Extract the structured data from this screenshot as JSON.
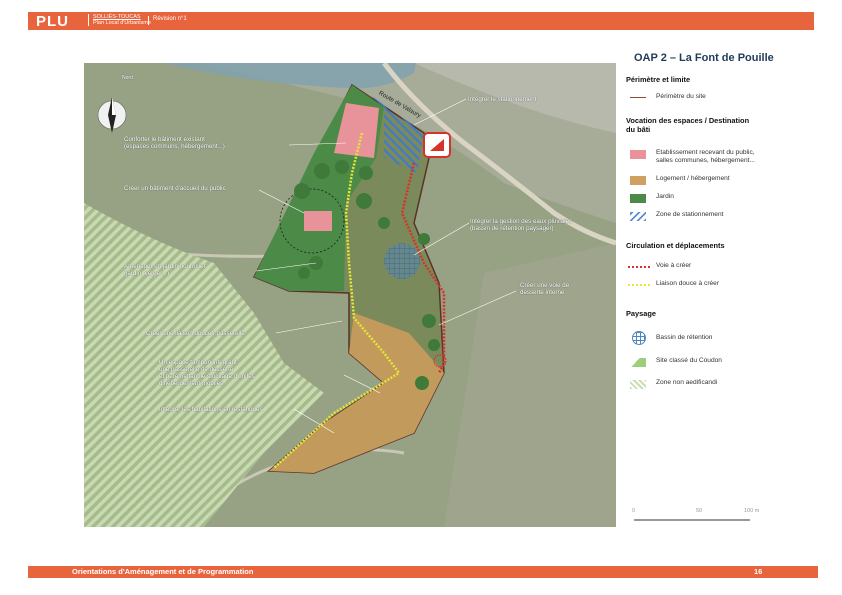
{
  "header": {
    "logo": "PLU",
    "commune": "SOLLIÈS-TOUCAS",
    "subtitle": "Plan Local d'Urbanisme",
    "revision": "Révision n°1"
  },
  "page_title": "OAP 2 – La Font de Pouille",
  "map": {
    "north_label": "Nord",
    "road_label": "Route de Valaury",
    "annotations": [
      "Intégrer le stationnement",
      "Conforter le bâtiment existant\n(espaces communs, hébergement...)",
      "Créer un bâtiment d'accueil du public",
      "Intégrer la gestion des eaux pluviales\n(bassin de rétention paysager)",
      "Aménager un jardin nourricier\n(jardin, verger...)",
      "Créer une voie de\ndesserte interne",
      "Créer une liaison douce / passerelle",
      "Un espace tampon intégrant\nune passerelle de desserte\net peremettant le stockage d'unités\nd'hébergement mobiles",
      "Intégrer les habitations en restanques"
    ]
  },
  "legend": {
    "sections": [
      "Périmètre et limite",
      "Vocation des espaces / Destination\ndu bâti",
      "Circulation et déplacements",
      "Paysage"
    ],
    "items": [
      {
        "label": "Périmètre du site",
        "color": "#8b4a3a"
      },
      {
        "label": "Etablissement recevant du public,\nsalles communes, hébergement...",
        "color": "#e8939a"
      },
      {
        "label": "Logement / hébergement",
        "color": "#d0a060"
      },
      {
        "label": "Jardin",
        "color": "#4c8a47"
      },
      {
        "label": "Zone de stationnement",
        "color": "#5b8ed0"
      },
      {
        "label": "Voie à créer",
        "color": "#d6322c"
      },
      {
        "label": "Liaison douce à créer",
        "color": "#e6e635"
      },
      {
        "label": "Bassin de rétention",
        "color": "#4f86c2"
      },
      {
        "label": "Site classé du Coudon",
        "color": "#9bcf7a"
      },
      {
        "label": "Zone non aedificandi",
        "color": "#c9dfb3"
      }
    ]
  },
  "scale": {
    "labels": [
      "0",
      "50",
      "100 m"
    ]
  },
  "footer": {
    "title": "Orientations d'Aménagement et de Programmation",
    "page": "16"
  }
}
